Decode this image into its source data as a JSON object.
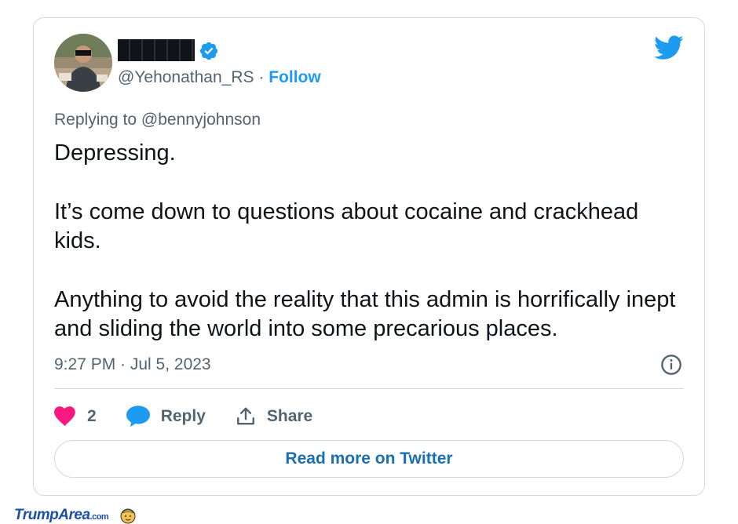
{
  "tweet": {
    "handle": "@Yehonathan_RS",
    "separator": " · ",
    "follow_label": "Follow",
    "replying_to": "Replying to @bennyjohnson",
    "paragraphs": [
      "Depressing.",
      "It’s come down to questions about cocaine and crackhead kids.",
      "Anything to avoid the reality that this admin is horrifically inept and sliding the world into some precarious places."
    ],
    "timestamp": "9:27 PM · Jul 5, 2023",
    "like_count": "2",
    "reply_label": "Reply",
    "share_label": "Share",
    "read_more_label": "Read more on Twitter"
  },
  "watermark": {
    "brand": "TrumpArea",
    "suffix": ".com"
  },
  "colors": {
    "accent": "#1d9bf0",
    "like": "#f91880",
    "muted": "#536471",
    "border": "#cfd9de"
  },
  "icons": [
    "verified-badge-icon",
    "twitter-bird-icon",
    "info-icon",
    "heart-icon",
    "reply-bubble-icon",
    "share-icon"
  ]
}
